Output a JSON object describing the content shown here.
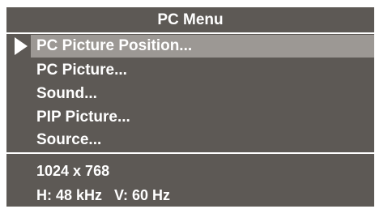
{
  "menu": {
    "title": "PC Menu",
    "items": [
      {
        "label": "PC Picture Position...",
        "selected": true
      },
      {
        "label": "PC Picture..."
      },
      {
        "label": "Sound..."
      },
      {
        "label": "PIP Picture..."
      },
      {
        "label": "Source..."
      }
    ]
  },
  "info": {
    "resolution": "1024 x 768",
    "frequency": "H: 48 kHz   V: 60 Hz"
  },
  "colors": {
    "panel_background": "#5d5955",
    "highlight": "#9c9894",
    "text": "#ffffff"
  },
  "icons": {
    "selection_cursor": "triangle-right-icon"
  }
}
